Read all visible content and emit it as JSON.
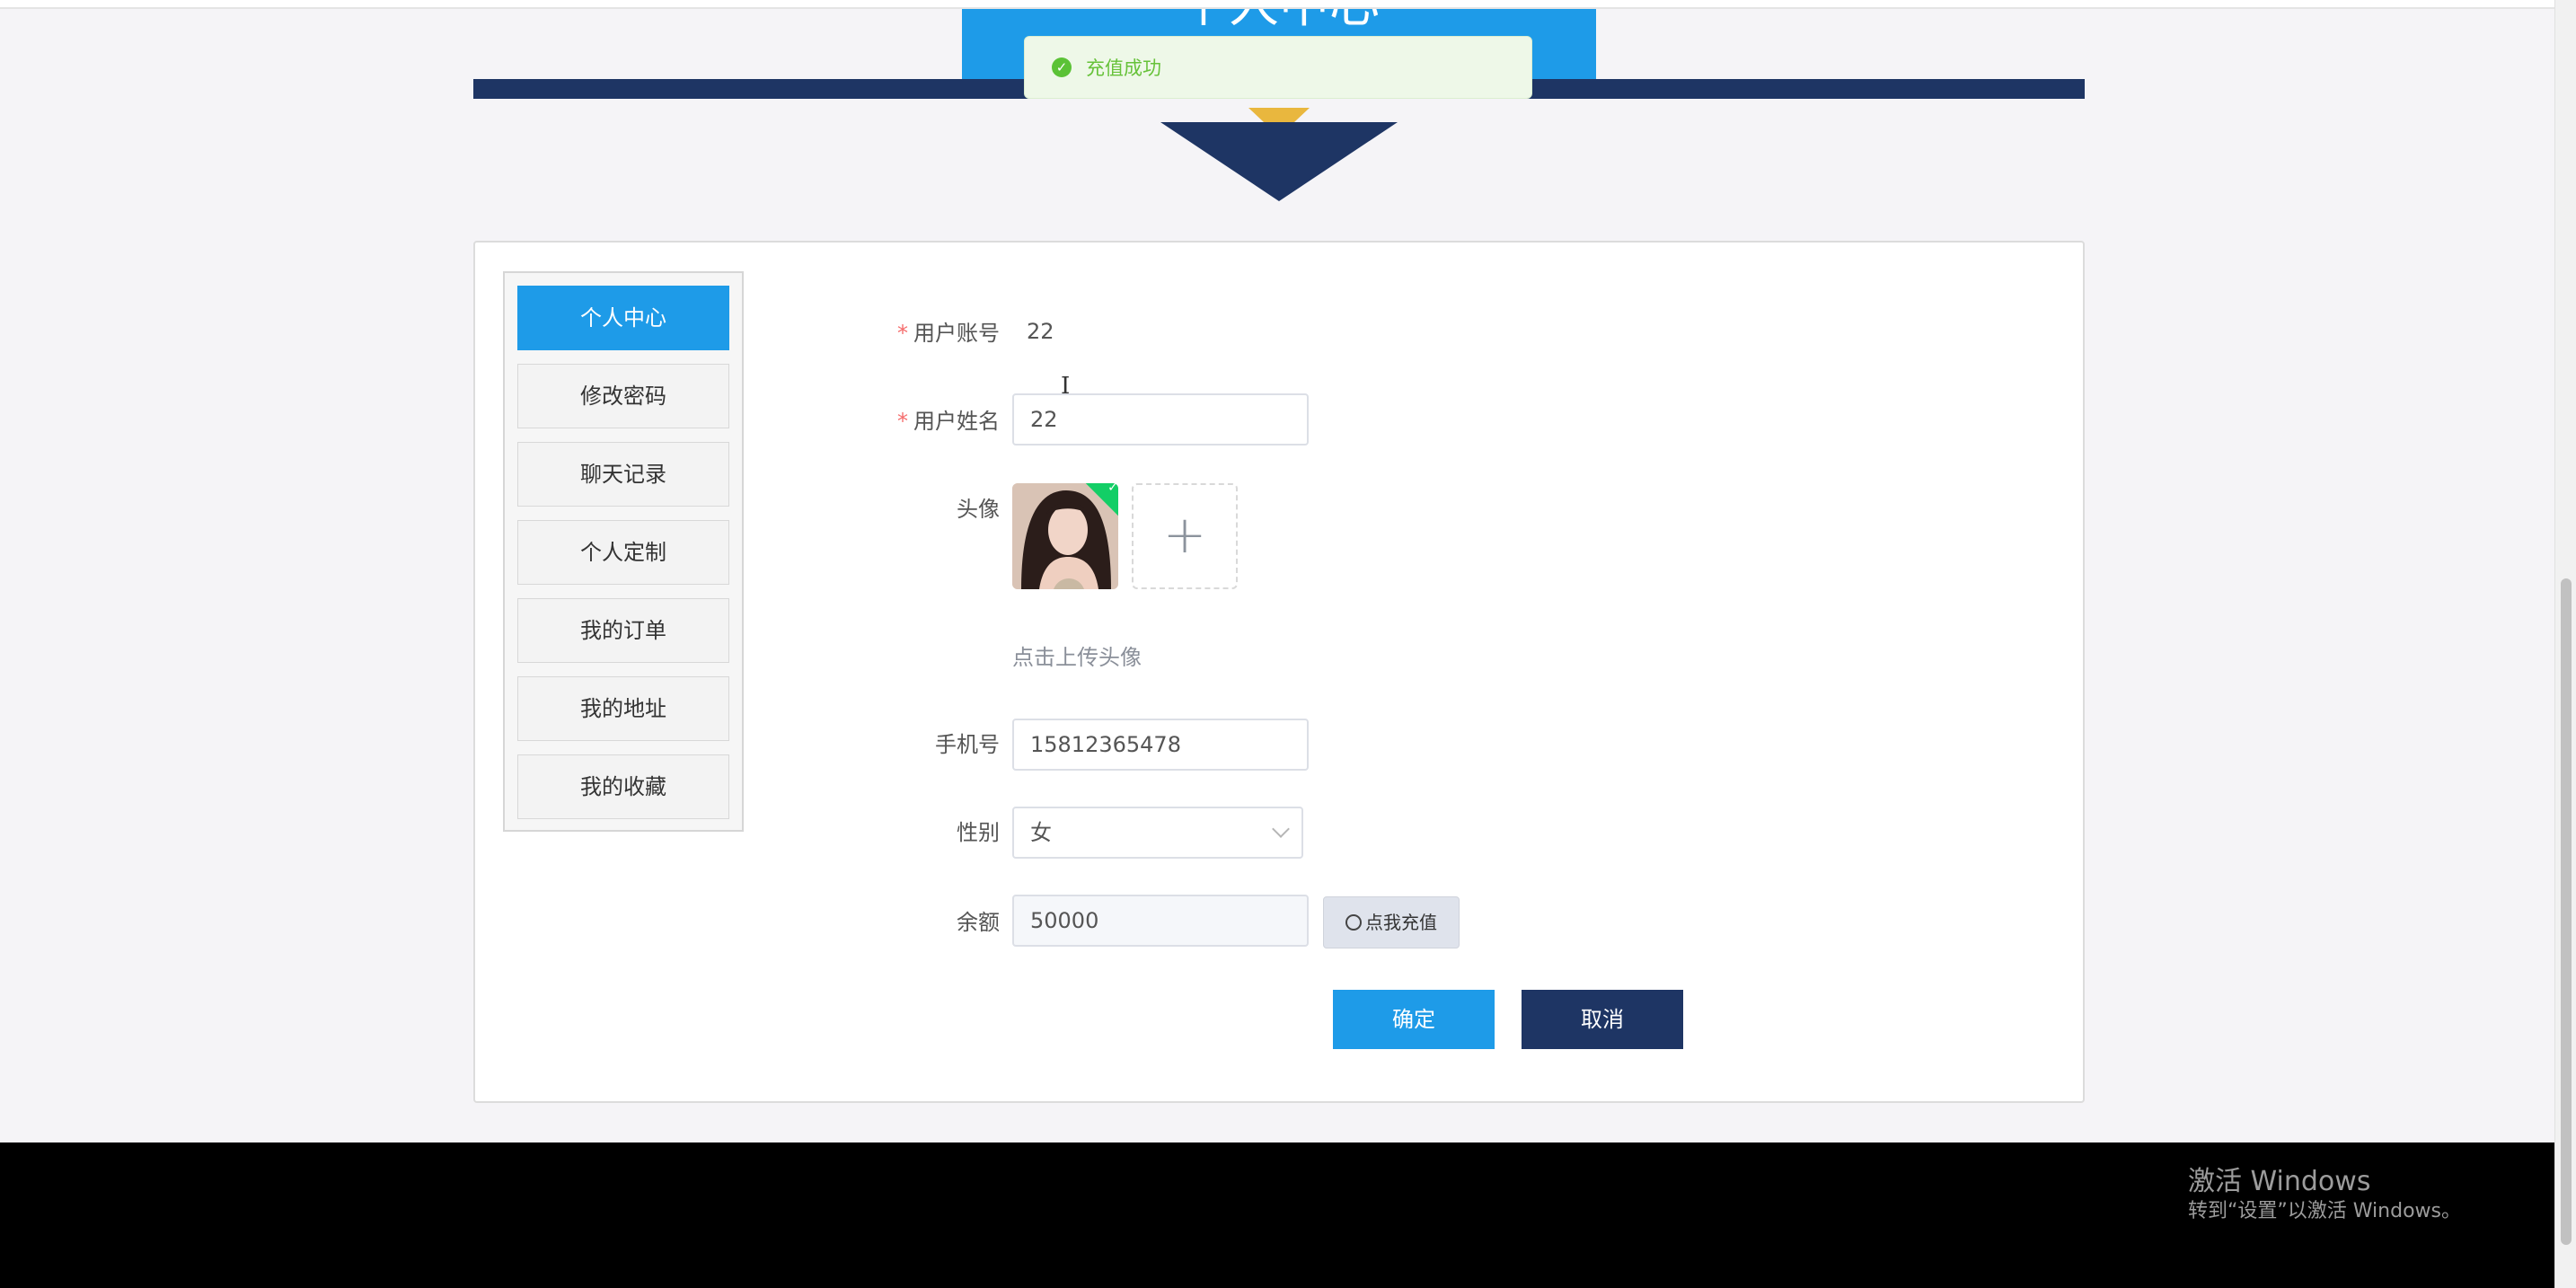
{
  "header": {
    "title": "个人中心"
  },
  "toast": {
    "message": "充值成功"
  },
  "menu": {
    "items": [
      {
        "label": "个人中心",
        "active": true
      },
      {
        "label": "修改密码"
      },
      {
        "label": "聊天记录"
      },
      {
        "label": "个人定制"
      },
      {
        "label": "我的订单"
      },
      {
        "label": "我的地址"
      },
      {
        "label": "我的收藏"
      }
    ]
  },
  "form": {
    "account_label": "用户账号",
    "account_value": "22",
    "name_label": "用户姓名",
    "name_value": "22",
    "avatar_label": "头像",
    "upload_hint": "点击上传头像",
    "phone_label": "手机号",
    "phone_value": "15812365478",
    "gender_label": "性别",
    "gender_value": "女",
    "balance_label": "余额",
    "balance_value": "50000",
    "recharge_button": "点我充值",
    "confirm_button": "确定",
    "cancel_button": "取消"
  },
  "watermark": {
    "line1": "激活 Windows",
    "line2": "转到“设置”以激活 Windows。"
  },
  "colors": {
    "primary": "#1e9be8",
    "navy": "#1e3564",
    "gold": "#e9b73e",
    "success": "#67c23a"
  }
}
